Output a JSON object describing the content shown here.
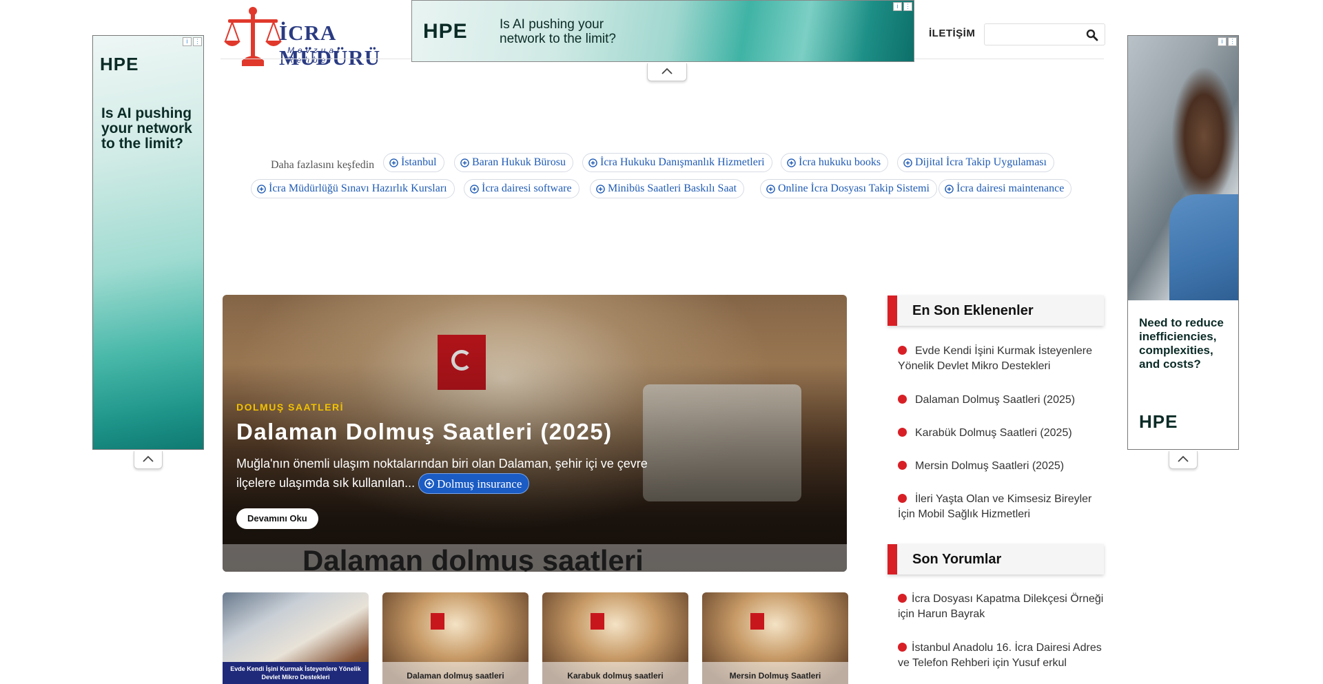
{
  "header": {
    "logo_title": "İCRA MÜDÜRÜ",
    "logo_sub": "Mevzuat Rehberi",
    "contact": "İLETİŞİM",
    "search_placeholder": ""
  },
  "ads": {
    "top": {
      "logo": "HPE",
      "text": "Is AI pushing your network to the limit?"
    },
    "left": {
      "logo": "HPE",
      "text": "Is AI pushing your network to the limit?"
    },
    "right": {
      "text": "Need to reduce inefficiencies, complexities, and costs?",
      "logo": "HPE"
    }
  },
  "explore": {
    "label": "Daha fazlasını keşfedin",
    "chips": [
      "İstanbul",
      "Baran Hukuk Bürosu",
      "İcra Hukuku Danışmanlık Hizmetleri",
      "İcra hukuku books",
      "Dijital İcra Takip Uygulaması",
      "İcra Müdürlüğü Sınavı Hazırlık Kursları",
      "İcra dairesi software",
      "Minibüs Saatleri Baskılı Saat",
      "Online İcra Dosyası Takip Sistemi",
      "İcra dairesi maintenance"
    ]
  },
  "hero": {
    "category": "DOLMUŞ SAATLERİ",
    "title": "Dalaman Dolmuş Saatleri (2025)",
    "excerpt": "Muğla'nın önemli ulaşım noktalarından biri olan Dalaman, şehir içi ve çevre ilçelere ulaşımda sık kullanılan...",
    "chip": "Dolmuş insurance",
    "button": "Devamını Oku",
    "image_caption": "Dalaman dolmuş saatleri"
  },
  "thumbs": [
    {
      "caption": "Evde Kendi İşini Kurmak İsteyenlere Yönelik Devlet Mikro Destekleri"
    },
    {
      "caption": "Dalaman dolmuş saatleri"
    },
    {
      "caption": "Karabuk dolmuş saatleri"
    },
    {
      "caption": "Mersin Dolmuş Saatleri"
    }
  ],
  "sidebar": {
    "latest_title": "En Son Eklenenler",
    "latest": [
      "Evde Kendi İşini Kurmak İsteyenlere Yönelik Devlet Mikro Destekleri",
      "Dalaman Dolmuş Saatleri (2025)",
      "Karabük Dolmuş Saatleri (2025)",
      "Mersin Dolmuş Saatleri (2025)",
      "İleri Yaşta Olan ve Kimsesiz Bireyler İçin Mobil Sağlık Hizmetleri"
    ],
    "comments_title": "Son Yorumlar",
    "comments": [
      "İcra Dosyası Kapatma Dilekçesi Örneği için Harun Bayrak",
      "İstanbul Anadolu 16. İcra Dairesi Adres ve Telefon Rehberi için Yusuf erkul"
    ]
  },
  "colors": {
    "accent_red": "#d81f26",
    "link_blue": "#1f5bb5",
    "brand_navy": "#2a3b82",
    "category_yellow": "#f2c200"
  }
}
